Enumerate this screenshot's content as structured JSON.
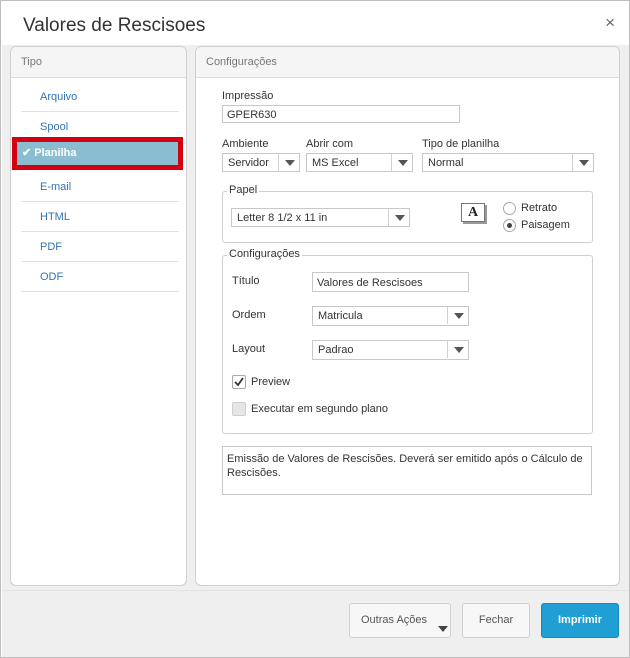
{
  "window": {
    "title": "Valores de Rescisoes",
    "close_icon": "×"
  },
  "tipo": {
    "header": "Tipo",
    "items": [
      {
        "label": "Arquivo"
      },
      {
        "label": "Spool"
      },
      {
        "label": "Planilha"
      },
      {
        "label": "E-mail"
      },
      {
        "label": "HTML"
      },
      {
        "label": "PDF"
      },
      {
        "label": "ODF"
      }
    ],
    "selected_check": "✔"
  },
  "config": {
    "header": "Configurações",
    "impressao": {
      "label": "Impressão",
      "value": "GPER630"
    },
    "ambiente": {
      "label": "Ambiente",
      "value": "Servidor"
    },
    "abrir_com": {
      "label": "Abrir com",
      "value": "MS Excel"
    },
    "tipo_planilha": {
      "label": "Tipo de planilha",
      "value": "Normal"
    },
    "papel": {
      "legend": "Papel",
      "size": "Letter 8 1/2 x 11 in",
      "orientation_icon": "A",
      "retrato": "Retrato",
      "paisagem": "Paisagem",
      "selected_orientation": "Paisagem"
    },
    "configuracoes": {
      "legend": "Configurações",
      "titulo": {
        "label": "Título",
        "value": "Valores de Rescisoes"
      },
      "ordem": {
        "label": "Ordem",
        "value": "Matricula"
      },
      "layout": {
        "label": "Layout",
        "value": "Padrao"
      },
      "preview": {
        "label": "Preview",
        "checked": true
      },
      "segundo_plano": {
        "label": "Executar em segundo plano",
        "checked": false,
        "disabled": true
      }
    },
    "descricao": "Emissão de Valores de Rescisões. Deverá ser emitido após o Cálculo de Rescisões."
  },
  "footer": {
    "outras_acoes": "Outras Ações",
    "fechar": "Fechar",
    "imprimir": "Imprimir"
  },
  "colors": {
    "primary": "#1f9fd4",
    "selected_bg": "#8bbdd0",
    "highlight_border": "#d40012",
    "link": "#2f74b5"
  }
}
